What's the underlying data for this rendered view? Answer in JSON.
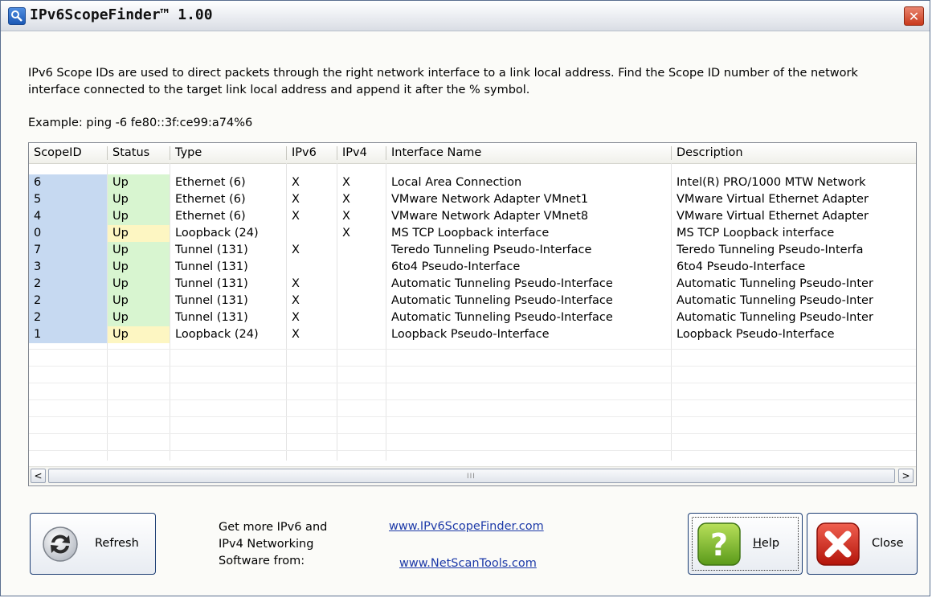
{
  "window": {
    "title": "IPv6ScopeFinder™ 1.00",
    "close_glyph": "✕"
  },
  "description": "IPv6 Scope IDs are used to direct packets through the right network interface to a link local address. Find the Scope ID number of the network interface connected to the target link local address and append it after the % symbol.",
  "example": "Example: ping -6 fe80::3f:ce99:a74%6",
  "table": {
    "columns": [
      "ScopeID",
      "Status",
      "Type",
      "IPv6",
      "IPv4",
      "Interface Name",
      "Description"
    ],
    "rows": [
      {
        "scopeid": "6",
        "status": "Up",
        "type": "Ethernet (6)",
        "ipv6": "X",
        "ipv4": "X",
        "name": "Local Area Connection",
        "description": "Intel(R) PRO/1000 MTW Network"
      },
      {
        "scopeid": "5",
        "status": "Up",
        "type": "Ethernet (6)",
        "ipv6": "X",
        "ipv4": "X",
        "name": "VMware Network Adapter VMnet1",
        "description": "VMware Virtual Ethernet Adapter"
      },
      {
        "scopeid": "4",
        "status": "Up",
        "type": "Ethernet (6)",
        "ipv6": "X",
        "ipv4": "X",
        "name": "VMware Network Adapter VMnet8",
        "description": "VMware Virtual Ethernet Adapter"
      },
      {
        "scopeid": "0",
        "status": "Up",
        "type": "Loopback (24)",
        "ipv6": "",
        "ipv4": "X",
        "name": "MS TCP Loopback interface",
        "description": "MS TCP Loopback interface"
      },
      {
        "scopeid": "7",
        "status": "Up",
        "type": "Tunnel (131)",
        "ipv6": "X",
        "ipv4": "",
        "name": "Teredo Tunneling Pseudo-Interface",
        "description": "Teredo Tunneling Pseudo-Interfa"
      },
      {
        "scopeid": "3",
        "status": "Up",
        "type": "Tunnel (131)",
        "ipv6": "",
        "ipv4": "",
        "name": "6to4 Pseudo-Interface",
        "description": "6to4 Pseudo-Interface"
      },
      {
        "scopeid": "2",
        "status": "Up",
        "type": "Tunnel (131)",
        "ipv6": "X",
        "ipv4": "",
        "name": "Automatic Tunneling Pseudo-Interface",
        "description": "Automatic Tunneling Pseudo-Inter"
      },
      {
        "scopeid": "2",
        "status": "Up",
        "type": "Tunnel (131)",
        "ipv6": "X",
        "ipv4": "",
        "name": "Automatic Tunneling Pseudo-Interface",
        "description": "Automatic Tunneling Pseudo-Inter"
      },
      {
        "scopeid": "2",
        "status": "Up",
        "type": "Tunnel (131)",
        "ipv6": "X",
        "ipv4": "",
        "name": "Automatic Tunneling Pseudo-Interface",
        "description": "Automatic Tunneling Pseudo-Inter"
      },
      {
        "scopeid": "1",
        "status": "Up",
        "type": "Loopback (24)",
        "ipv6": "X",
        "ipv4": "",
        "name": "Loopback Pseudo-Interface",
        "description": "Loopback Pseudo-Interface"
      }
    ],
    "colors": {
      "scopeid_bg": "#c6d9f1",
      "status_ethernet_bg": "#d8f5d0",
      "status_loopback_bg": "#fdf6c2"
    },
    "scrollbar": {
      "left_glyph": "<",
      "right_glyph": ">",
      "grip": "III"
    }
  },
  "buttons": {
    "refresh": {
      "label": "Refresh",
      "icon": "refresh-icon"
    },
    "help": {
      "label": "Help",
      "icon": "question-icon"
    },
    "close": {
      "label": "Close",
      "icon": "close-x-icon"
    }
  },
  "promo": {
    "line1": "Get more IPv6 and",
    "line2": "IPv4 Networking",
    "line3": "Software from:"
  },
  "links": {
    "site1": "www.IPv6ScopeFinder.com",
    "site2": "www.NetScanTools.com"
  }
}
